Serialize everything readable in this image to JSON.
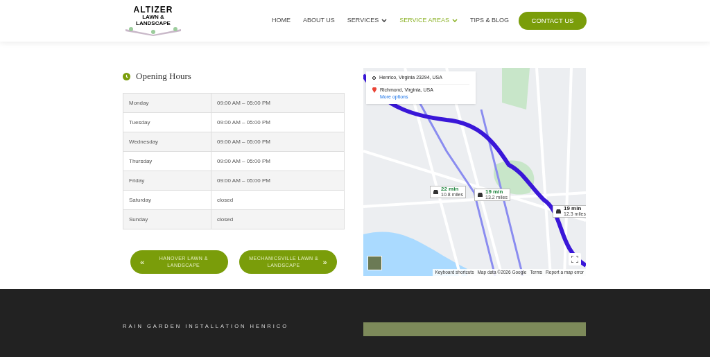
{
  "header": {
    "logo": {
      "line_1": "ALTIZER",
      "line_2": "LAWN &",
      "line_3": "LANDSCAPE"
    },
    "nav": [
      {
        "label": "HOME",
        "selected": false,
        "dropdown": false
      },
      {
        "label": "ABOUT US",
        "selected": false,
        "dropdown": false
      },
      {
        "label": "SERVICES",
        "selected": false,
        "dropdown": true
      },
      {
        "label": "SERVICE AREAS",
        "selected": true,
        "dropdown": true
      },
      {
        "label": "TIPS & BLOG",
        "selected": false,
        "dropdown": false
      }
    ],
    "contact_button": "CONTACT US"
  },
  "opening_hours": {
    "title": "Opening Hours",
    "rows": [
      {
        "day": "Monday",
        "hours": "09:00 AM – 05:00 PM"
      },
      {
        "day": "Tuesday",
        "hours": "09:00 AM – 05:00 PM"
      },
      {
        "day": "Wednesday",
        "hours": "09:00 AM – 05:00 PM"
      },
      {
        "day": "Thursday",
        "hours": "09:00 AM – 05:00 PM"
      },
      {
        "day": "Friday",
        "hours": "09:00 AM – 05:00 PM"
      },
      {
        "day": "Saturday",
        "hours": "closed"
      },
      {
        "day": "Sunday",
        "hours": "closed"
      }
    ]
  },
  "nav_buttons": [
    {
      "label": "HANOVER LAWN & LANDSCAPE",
      "kind": "prev",
      "icon": "«"
    },
    {
      "label": "MECHANICSVILLE LAWN & LANDSCAPE",
      "kind": "next",
      "icon": "»"
    }
  ],
  "map": {
    "origin": "Henrico, Virginia 23294, USA",
    "destination": "Richmond, Virginia, USA",
    "more_options": "More options",
    "routes": [
      {
        "time": "22 min",
        "distance": "10.8 miles"
      },
      {
        "time": "19 min",
        "distance": "13.2 miles"
      },
      {
        "time": "19 min",
        "distance": "12.3 miles"
      }
    ],
    "footer_links": [
      "Keyboard shortcuts",
      "Map data ©2026 Google",
      "Terms",
      "Report a map error"
    ]
  },
  "footer_section": {
    "heading": "RAIN GARDEN INSTALLATION HENRICO"
  }
}
